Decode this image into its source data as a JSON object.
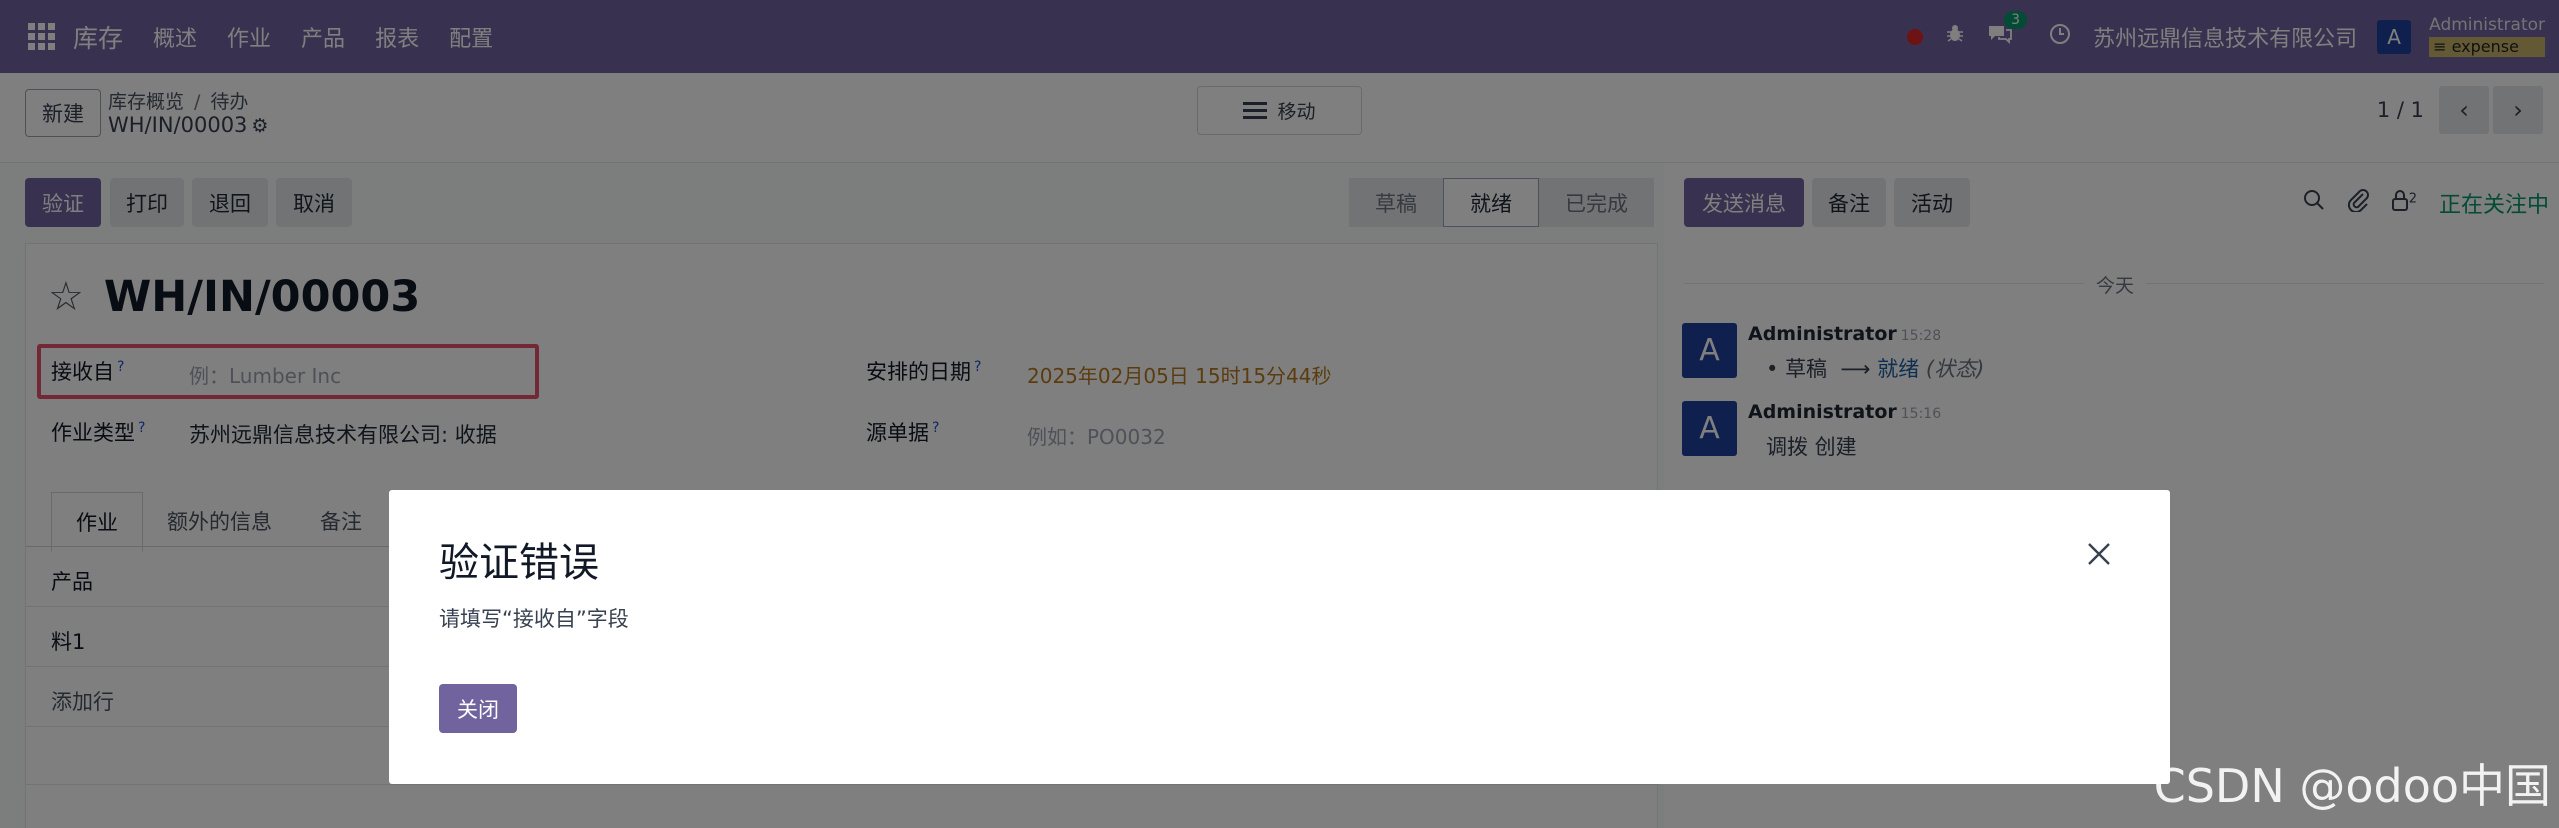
{
  "topnav": {
    "app_name": "库存",
    "menu": [
      "概述",
      "作业",
      "产品",
      "报表",
      "配置"
    ],
    "messages_badge": "3",
    "company": "苏州远鼎信息技术有限公司",
    "avatar_letter": "A",
    "user_name": "Administrator",
    "database": "expense"
  },
  "control": {
    "new_label": "新建",
    "breadcrumb": [
      "库存概览",
      "待办"
    ],
    "record_name": "WH/IN/00003",
    "move_label": "移动",
    "pager": "1 / 1"
  },
  "actions": {
    "validate": "验证",
    "print": "打印",
    "return": "退回",
    "cancel": "取消"
  },
  "status": {
    "steps": [
      "草稿",
      "就绪",
      "已完成"
    ],
    "active": "就绪"
  },
  "form": {
    "title": "WH/IN/00003",
    "receive_from_label": "接收自",
    "receive_from_placeholder": "例：Lumber Inc",
    "operation_type_label": "作业类型",
    "operation_type_value": "苏州远鼎信息技术有限公司: 收据",
    "scheduled_date_label": "安排的日期",
    "scheduled_date_value": "2025年02月05日 15时15分44秒",
    "source_doc_label": "源单据",
    "source_doc_placeholder": "例如：PO0032",
    "tabs": [
      "作业",
      "额外的信息",
      "备注"
    ],
    "product_header": "产品",
    "rows": [
      "料1"
    ],
    "add_line": "添加行"
  },
  "chatter": {
    "send_message": "发送消息",
    "log_note": "备注",
    "activities": "活动",
    "followers_count": "2",
    "following": "正在关注中",
    "today": "今天",
    "messages": [
      {
        "author": "Administrator",
        "time": "15:28",
        "from": "草稿",
        "arrow": "⟶",
        "to": "就绪",
        "field": "(状态)"
      },
      {
        "author": "Administrator",
        "time": "15:16",
        "text": "调拨 创建"
      }
    ]
  },
  "modal": {
    "title": "验证错误",
    "body": "请填写“接收自”字段",
    "close_label": "关闭"
  },
  "watermark": "CSDN @odoo中国"
}
